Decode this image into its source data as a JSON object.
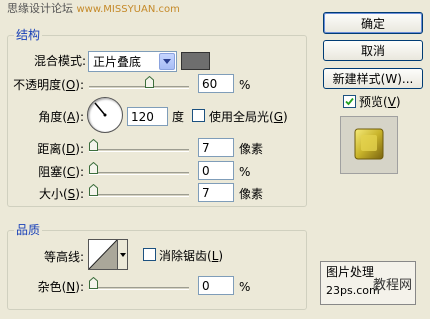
{
  "watermark": {
    "prefix": "思缘设计论坛",
    "site": "www.MISSYUAN.com"
  },
  "structure": {
    "legend": "结构",
    "blend_mode": {
      "label": "混合模式:",
      "value": "正片叠底"
    },
    "opacity": {
      "label": "不透明度(",
      "key": "O",
      "suffix": "):",
      "value": "60",
      "unit": "%",
      "level": 0.6
    },
    "angle": {
      "label": "角度(",
      "key": "A",
      "suffix": "):",
      "value": "120",
      "unit": "度"
    },
    "global_light": {
      "label": "使用全局光(",
      "key": "G",
      "suffix": ")",
      "checked": false
    },
    "distance": {
      "label": "距离(",
      "key": "D",
      "suffix": "):",
      "value": "7",
      "unit": "像素"
    },
    "choke": {
      "label": "阻塞(",
      "key": "C",
      "suffix": "):",
      "value": "0",
      "unit": "%"
    },
    "size": {
      "label": "大小(",
      "key": "S",
      "suffix": "):",
      "value": "7",
      "unit": "像素"
    }
  },
  "quality": {
    "legend": "品质",
    "contour": {
      "label": "等高线:"
    },
    "antialias": {
      "label": "消除锯齿(",
      "key": "L",
      "suffix": ")",
      "checked": false
    },
    "noise": {
      "label": "杂色(",
      "key": "N",
      "suffix": "):",
      "value": "0",
      "unit": "%"
    }
  },
  "buttons": {
    "ok": "确定",
    "cancel": "取消",
    "new_style": "新建样式(W)..."
  },
  "preview": {
    "label": "预览(",
    "key": "V",
    "suffix": ")",
    "checked": true
  },
  "brand": {
    "line1": "图片处理",
    "line2": "教程网",
    "url": "23ps.com"
  },
  "colors": {
    "swatch": "#6e6e6e",
    "legend": "#1840b8",
    "preview_gold": "#c8b32a"
  }
}
